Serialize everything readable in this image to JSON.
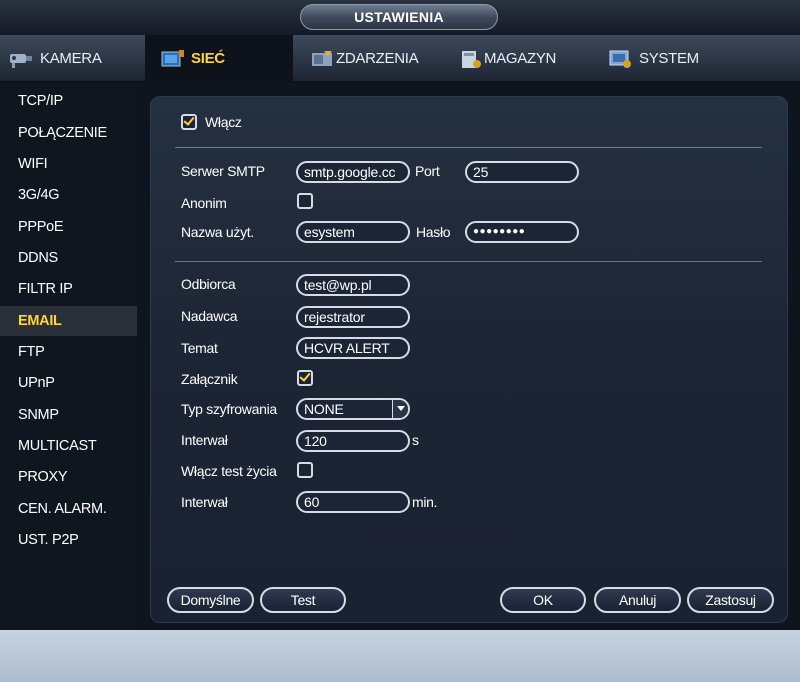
{
  "window": {
    "title": "USTAWIENIA"
  },
  "tabs": [
    {
      "label": "KAMERA",
      "icon": "camera-icon"
    },
    {
      "label": "SIEĆ",
      "icon": "network-icon",
      "active": true
    },
    {
      "label": "ZDARZENIA",
      "icon": "events-icon"
    },
    {
      "label": "MAGAZYN",
      "icon": "storage-icon"
    },
    {
      "label": "SYSTEM",
      "icon": "system-icon"
    }
  ],
  "sidebar": {
    "items": [
      "TCP/IP",
      "POŁĄCZENIE",
      "WIFI",
      "3G/4G",
      "PPPoE",
      "DDNS",
      "FILTR IP",
      "EMAIL",
      "FTP",
      "UPnP",
      "SNMP",
      "MULTICAST",
      "PROXY",
      "CEN. ALARM.",
      "UST. P2P"
    ],
    "active": "EMAIL"
  },
  "form": {
    "enable": {
      "label": "Włącz",
      "checked": true
    },
    "smtp_server": {
      "label": "Serwer SMTP",
      "value": "smtp.google.cc"
    },
    "port": {
      "label": "Port",
      "value": "25"
    },
    "anonymous": {
      "label": "Anonim",
      "checked": false
    },
    "username": {
      "label": "Nazwa użyt.",
      "value": "esystem"
    },
    "password": {
      "label": "Hasło",
      "value": "●●●●●●●●"
    },
    "recipient": {
      "label": "Odbiorca",
      "value": "test@wp.pl"
    },
    "sender": {
      "label": "Nadawca",
      "value": "rejestrator"
    },
    "subject": {
      "label": "Temat",
      "value": "HCVR ALERT"
    },
    "attachment": {
      "label": "Załącznik",
      "checked": true
    },
    "encryption": {
      "label": "Typ szyfrowania",
      "value": "NONE"
    },
    "interval": {
      "label": "Interwał",
      "value": "120",
      "unit": "s"
    },
    "health_test": {
      "label": "Włącz test życia",
      "checked": false
    },
    "health_interval": {
      "label": "Interwał",
      "value": "60",
      "unit": "min."
    }
  },
  "buttons": {
    "default": "Domyślne",
    "test": "Test",
    "ok": "OK",
    "cancel": "Anuluj",
    "apply": "Zastosuj"
  },
  "colors": {
    "accent": "#ffd531",
    "panel": "#1c2534",
    "sidebar": "#101620"
  }
}
